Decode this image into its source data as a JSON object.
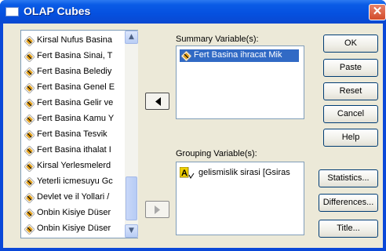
{
  "window": {
    "title": "OLAP Cubes"
  },
  "source_list": {
    "items": [
      "Kirsal Nufus Basina",
      "Fert Basina Sinai, T",
      "Fert Basina Belediy",
      "Fert Basina Genel E",
      "Fert Basina Gelir ve",
      "Fert Basina Kamu Y",
      "Fert Basina Tesvik",
      "Fert Basina ithalat I",
      "Kirsal Yerlesmelerd",
      "Yeterli icmesuyu Gc",
      "Devlet ve il Yollari /",
      "Onbin Kisiye Düser",
      "Onbin Kisiye Düser"
    ]
  },
  "summary": {
    "label": "Summary Variable(s):",
    "items": [
      "Fert Basina ihracat Mik"
    ]
  },
  "grouping": {
    "label": "Grouping Variable(s):",
    "items": [
      "gelismislik sirasi [Gsiras"
    ]
  },
  "buttons": {
    "ok": "OK",
    "paste": "Paste",
    "reset": "Reset",
    "cancel": "Cancel",
    "help": "Help",
    "statistics": "Statistics...",
    "differences": "Differences...",
    "title": "Title..."
  },
  "colors": {
    "titlebar": "#0a5ce6",
    "dialog_bg": "#ece9d8",
    "selection": "#316ac5",
    "close_button": "#d24b2a"
  },
  "icons": {
    "scale_variable": "ruler-diamond-icon",
    "nominal_variable": "nominal-variable-icon"
  }
}
